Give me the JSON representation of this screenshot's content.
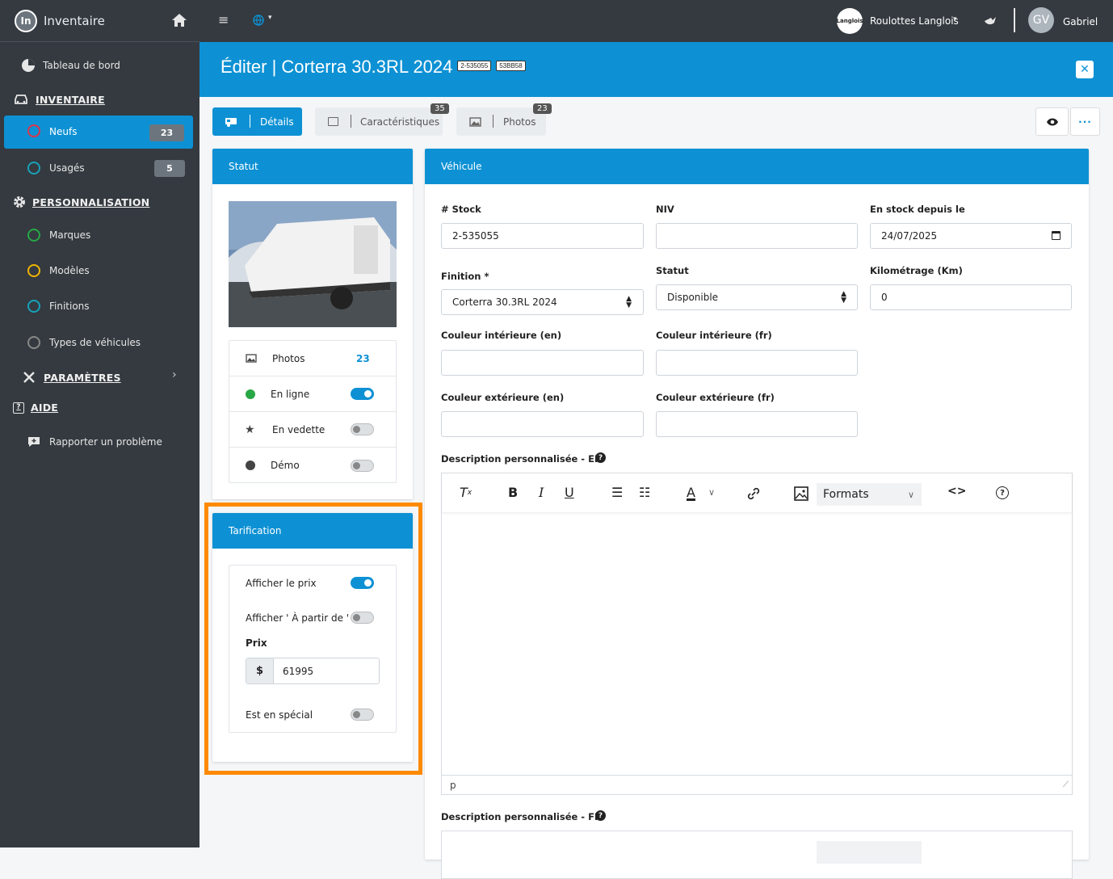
{
  "app": {
    "name": "Inventaire",
    "logo_text": "In"
  },
  "sidebar": {
    "dashboard": "Tableau de bord",
    "inventory_heading": "INVENTAIRE",
    "neufs": {
      "label": "Neufs",
      "count": "23"
    },
    "usages": {
      "label": "Usagés",
      "count": "5"
    },
    "custom_heading": "PERSONNALISATION",
    "marques": "Marques",
    "modeles": "Modèles",
    "finitions": "Finitions",
    "types": "Types de véhicules",
    "params_heading": "PARAMÈTRES",
    "help_heading": "AIDE",
    "report": "Rapporter un problème"
  },
  "topbar": {
    "dealer": "Roulottes Langlois",
    "dealer_logo_text": "Langlois",
    "avatar": "GV",
    "user": "Gabriel"
  },
  "header": {
    "title": "Éditer | Corterra 30.3RL 2024",
    "tag1": "2-535055",
    "tag2": "53BB58"
  },
  "tabs": [
    {
      "label": "Détails"
    },
    {
      "label": "Caractéristiques",
      "badge": "35"
    },
    {
      "label": "Photos",
      "badge": "23"
    }
  ],
  "statut": {
    "title": "Statut",
    "photos": {
      "label": "Photos",
      "count": "23"
    },
    "enligne": "En ligne",
    "vedette": "En vedette",
    "demo": "Démo"
  },
  "tarif": {
    "title": "Tarification",
    "show_price": "Afficher le prix",
    "show_from": "Afficher ' À partir de '",
    "price_label": "Prix",
    "currency": "$",
    "price": "61995",
    "special": "Est en spécial"
  },
  "vehicule": {
    "title": "Véhicule",
    "stock_label": "# Stock",
    "stock": "2-535055",
    "niv_label": "NIV",
    "niv": "",
    "since_label": "En stock depuis le",
    "since": "24/07/2025",
    "finition_label": "Finition *",
    "finition": "Corterra 30.3RL 2024",
    "statut_label": "Statut",
    "statut": "Disponible",
    "km_label": "Kilométrage (Km)",
    "km": "0",
    "int_en_label": "Couleur intérieure (en)",
    "int_fr_label": "Couleur intérieure (fr)",
    "ext_en_label": "Couleur extérieure (en)",
    "ext_fr_label": "Couleur extérieure (fr)",
    "desc_en_label": "Description personnalisée - EN",
    "desc_fr_label": "Description personnalisée - FR",
    "formats": "Formats",
    "status_path": "p"
  }
}
